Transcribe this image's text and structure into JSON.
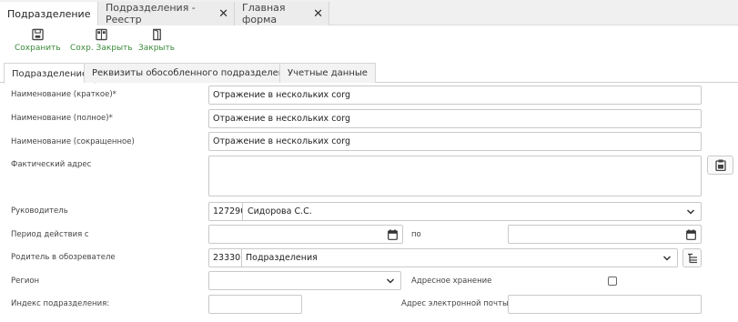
{
  "tabs": [
    {
      "label": "Подразделение"
    },
    {
      "label": "Подразделения - Реестр"
    },
    {
      "label": "Главная форма"
    }
  ],
  "toolbar": {
    "save_label": "Сохранить",
    "save_close_label": "Сохр. Закрыть",
    "close_label": "Закрыть"
  },
  "form_tabs": [
    {
      "label": "Подразделение"
    },
    {
      "label": "Реквизиты обособленного подразделения"
    },
    {
      "label": "Учетные данные"
    }
  ],
  "form": {
    "short_name_label": "Наименование (краткое)*",
    "short_name_value": "Отражение в нескольких corg",
    "full_name_label": "Наименование (полное)*",
    "full_name_value": "Отражение в  нескольких corg",
    "abbr_name_label": "Наименование (сокращенное)",
    "abbr_name_value": "Отражение в  нескольких corg",
    "address_label": "Фактический адрес",
    "address_value": "",
    "manager_label": "Руководитель",
    "manager_code": "127290",
    "manager_value": "Сидорова С.С.",
    "period_label": "Период действия с",
    "period_from": "",
    "period_to_label": "по",
    "period_to": "",
    "parent_label": "Родитель в обозревателе",
    "parent_code": "23330",
    "parent_value": "Подразделения",
    "region_label": "Регион",
    "region_value": "",
    "address_storage_label": "Адресное хранение",
    "index_label": "Индекс подразделения:",
    "index_value": "",
    "email_label": "Адрес электронной почты",
    "email_value": ""
  },
  "colors": {
    "accent_green": "#3a8a3a",
    "tabbar_bg": "#f0f0f0",
    "border": "#c9c9c9"
  }
}
